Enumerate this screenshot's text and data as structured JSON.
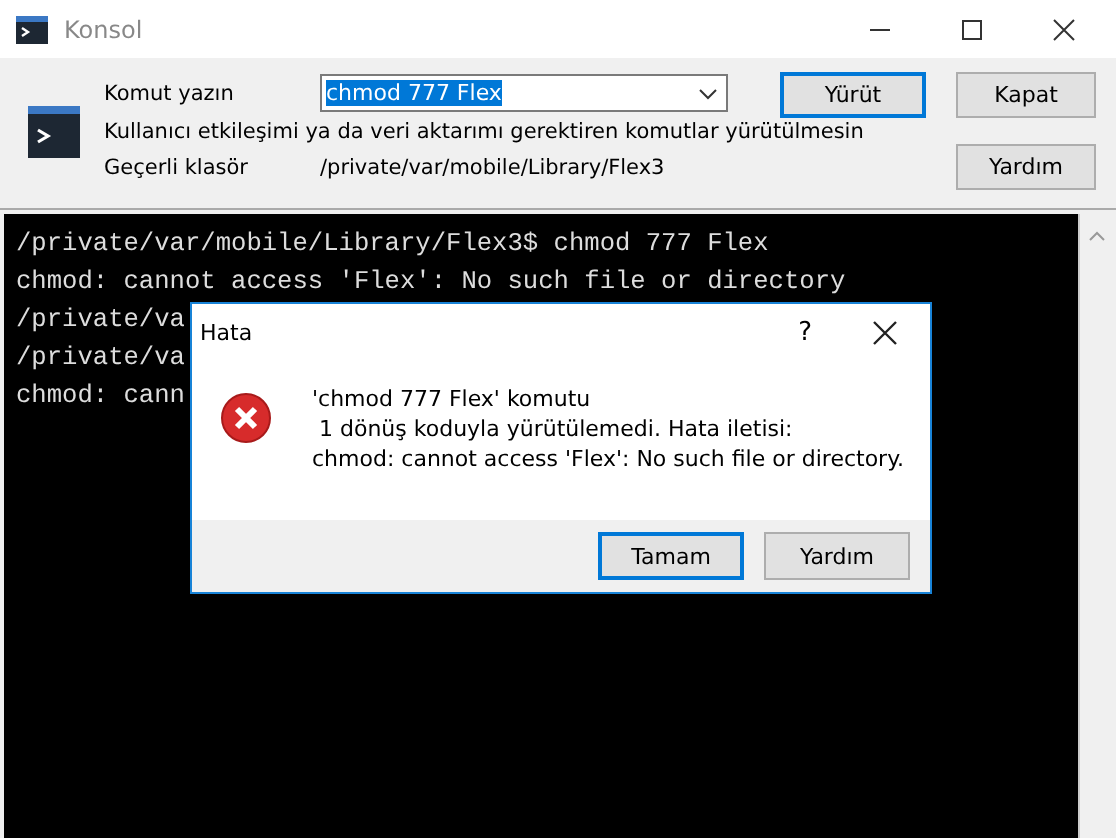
{
  "window": {
    "title": "Konsol"
  },
  "command": {
    "label": "Komut yazın",
    "value": "chmod 777 Flex",
    "selected_text": true
  },
  "options": {
    "no_interactive": {
      "label": "Kullanıcı etkileşimi ya da veri aktarımı gerektiren komutlar yürütülmesin"
    }
  },
  "current_folder": {
    "label": "Geçerli klasör",
    "value": "/private/var/mobile/Library/Flex3"
  },
  "buttons": [
    {
      "label": "Yürüt",
      "default": true
    },
    {
      "label": "Kapat",
      "default": false
    },
    {
      "label": "Yardım",
      "default": false
    }
  ],
  "terminal": {
    "lines": [
      "/private/var/mobile/Library/Flex3$ chmod 777 Flex",
      "chmod: cannot access 'Flex': No such file or directory",
      "/private/va",
      "/private/va",
      "chmod: cann"
    ]
  },
  "dialog": {
    "title": "Hata",
    "help": "?",
    "message_lines": [
      "'chmod 777 Flex' komutu",
      " 1 dönüş koduyla yürütülemedi. Hata iletisi:",
      "chmod: cannot access 'Flex': No such file or directory."
    ],
    "buttons": [
      {
        "label": "Tamam",
        "default": true
      },
      {
        "label": "Yardım",
        "default": false
      }
    ]
  }
}
